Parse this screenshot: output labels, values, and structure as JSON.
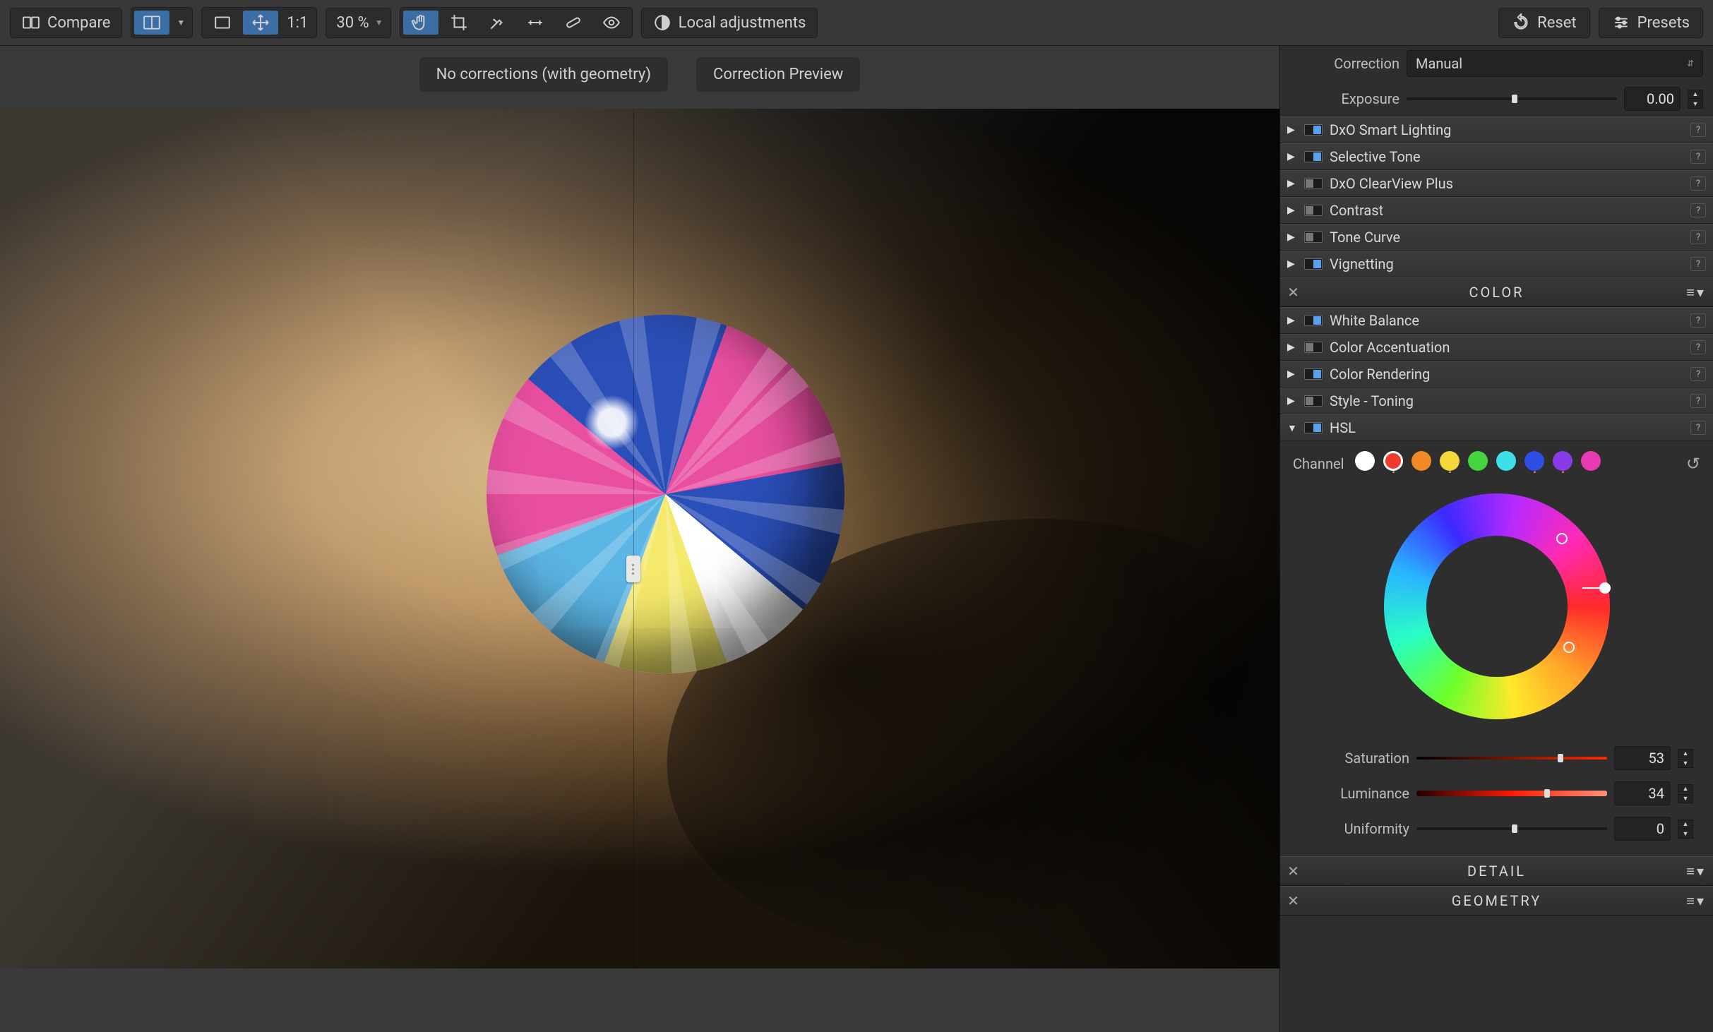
{
  "toolbar": {
    "compare": "Compare",
    "ratio": "1:1",
    "zoom": "30 %",
    "local_adjustments": "Local adjustments",
    "reset": "Reset",
    "presets": "Presets"
  },
  "viewer": {
    "left_label": "No corrections (with geometry)",
    "right_label": "Correction Preview"
  },
  "panel": {
    "correction": {
      "label": "Correction",
      "value": "Manual"
    },
    "exposure": {
      "label": "Exposure",
      "value": "0.00",
      "pos": 50
    },
    "light_sections": [
      {
        "name": "DxO Smart Lighting",
        "on": true
      },
      {
        "name": "Selective Tone",
        "on": true
      },
      {
        "name": "DxO ClearView Plus",
        "on": false
      },
      {
        "name": "Contrast",
        "on": false
      },
      {
        "name": "Tone Curve",
        "on": false
      },
      {
        "name": "Vignetting",
        "on": true
      }
    ],
    "cat_color": "COLOR",
    "color_sections": [
      {
        "name": "White Balance",
        "on": true
      },
      {
        "name": "Color Accentuation",
        "on": false
      },
      {
        "name": "Color Rendering",
        "on": true
      },
      {
        "name": "Style - Toning",
        "on": false
      }
    ],
    "hsl": {
      "title": "HSL",
      "on": true,
      "channel_label": "Channel",
      "selected_index": 1,
      "saturation": {
        "label": "Saturation",
        "value": "53",
        "pos": 74
      },
      "luminance": {
        "label": "Luminance",
        "value": "34",
        "pos": 67
      },
      "uniformity": {
        "label": "Uniformity",
        "value": "0",
        "pos": 50
      }
    },
    "cat_detail": "DETAIL",
    "cat_geometry": "GEOMETRY"
  }
}
